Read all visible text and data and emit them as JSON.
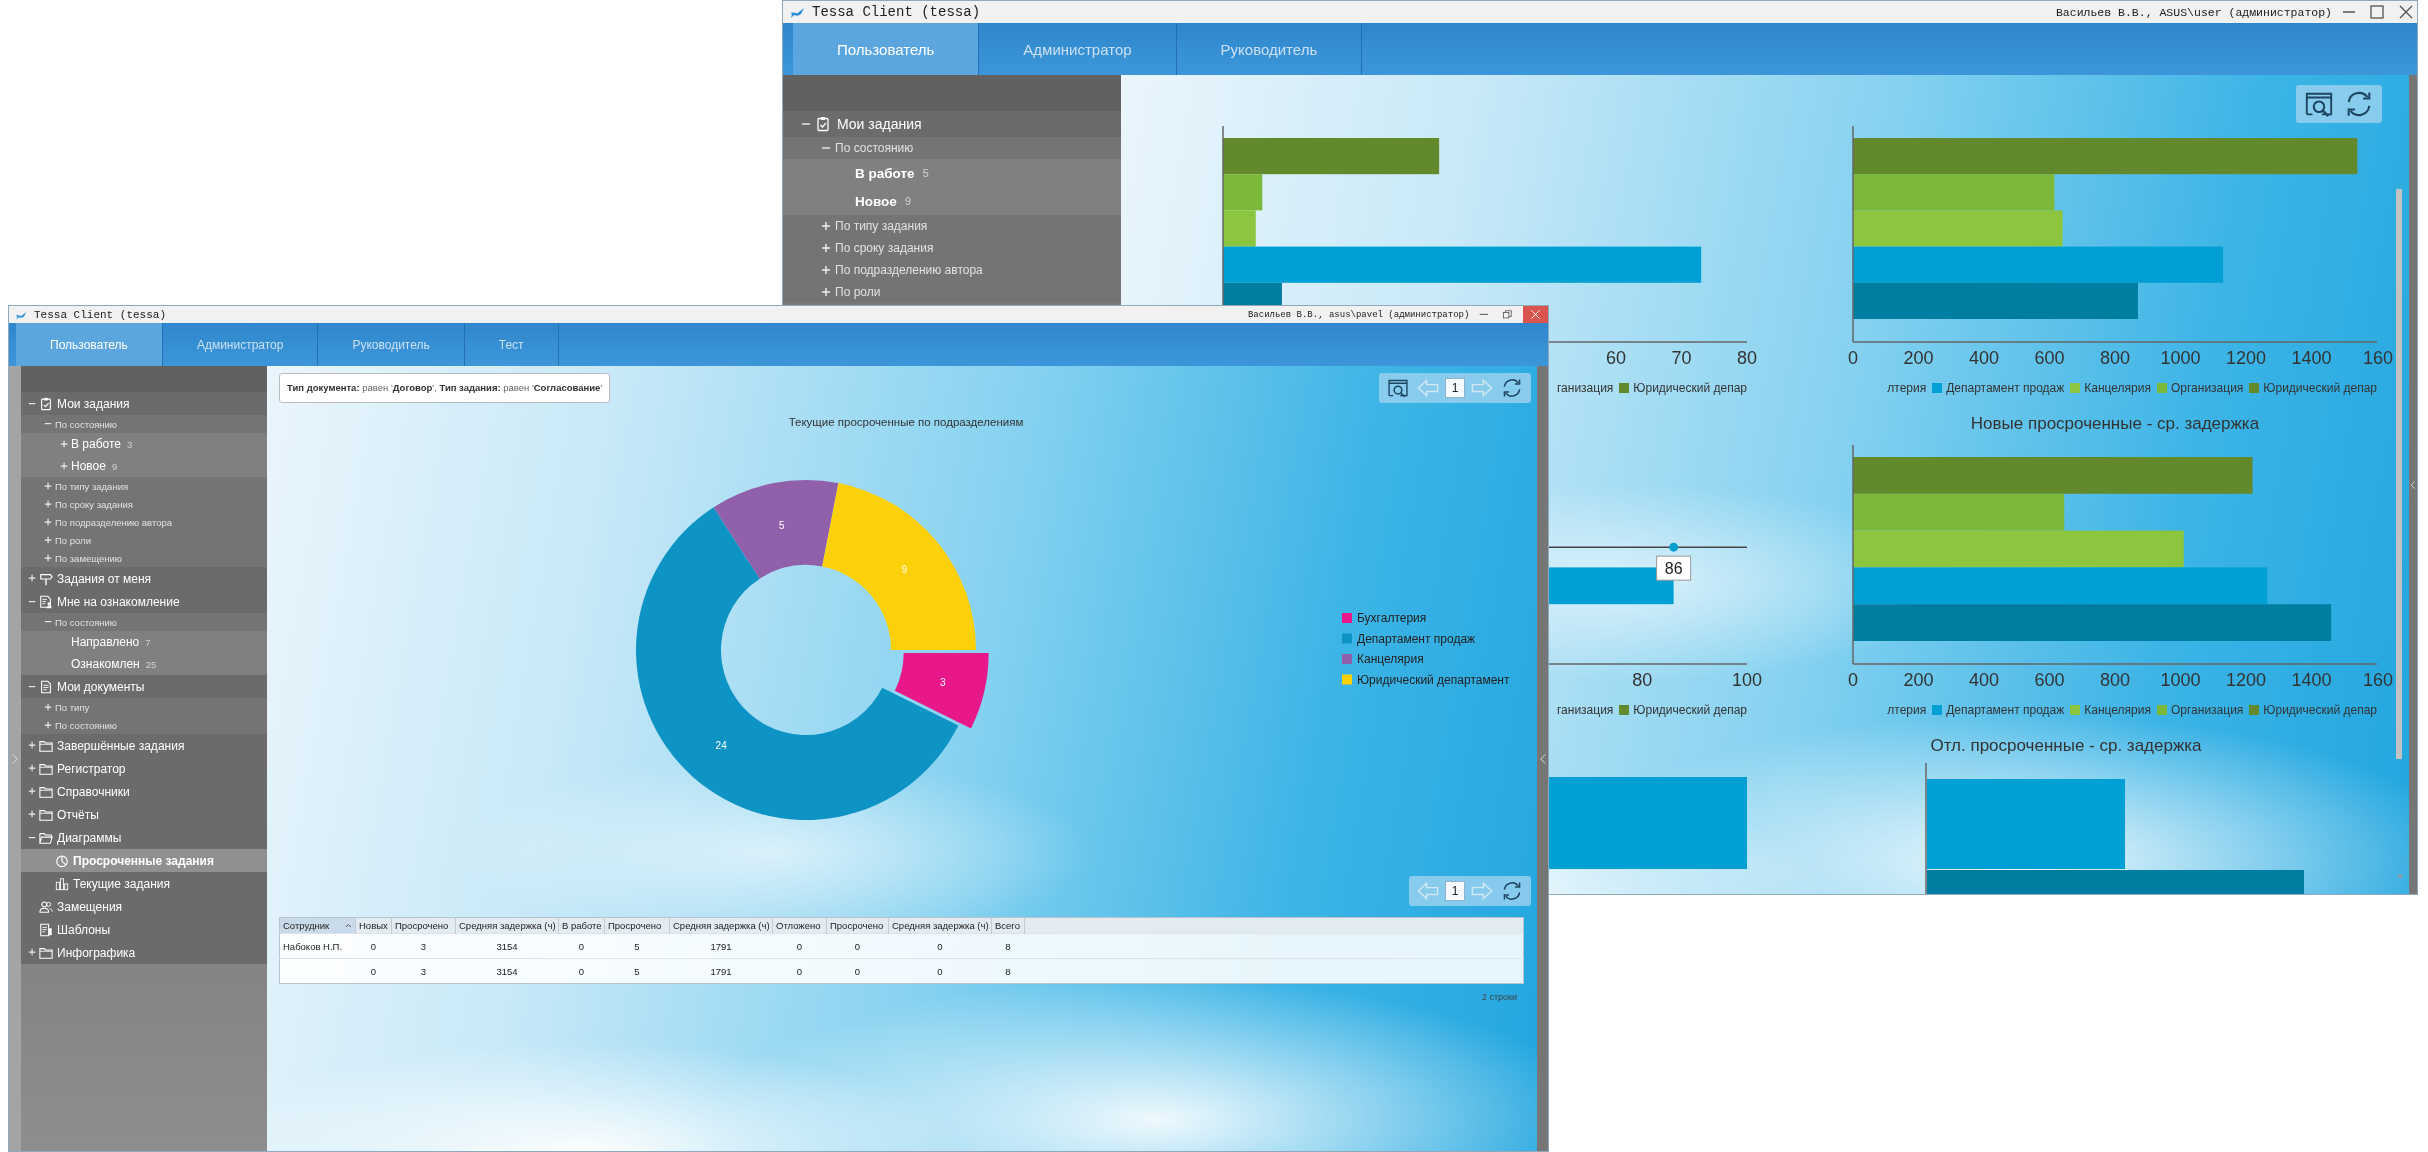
{
  "back_window": {
    "title": "Tessa Client (tessa)",
    "user": "Васильев В.В., ASUS\\user (администратор)",
    "tabs": [
      {
        "label": "Пользователь",
        "selected": true
      },
      {
        "label": "Администратор",
        "selected": false
      },
      {
        "label": "Руководитель",
        "selected": false
      }
    ],
    "sidebar": [
      {
        "label": "Мои задания",
        "kind": "clipboard",
        "expanded": true,
        "children": [
          {
            "label": "По состоянию",
            "expanded": true,
            "children": [
              {
                "label": "В работе",
                "count": "5"
              },
              {
                "label": "Новое",
                "count": "9"
              }
            ]
          },
          {
            "label": "По типу задания",
            "expanded": false
          },
          {
            "label": "По сроку задания",
            "expanded": false
          },
          {
            "label": "По подразделению автора",
            "expanded": false
          },
          {
            "label": "По роли",
            "expanded": false
          }
        ]
      }
    ],
    "toolbar": [
      {
        "kind": "search"
      },
      {
        "kind": "refresh"
      }
    ],
    "charts": [
      {
        "kind": "chart",
        "chart_data": {
          "type": "bar",
          "orientation": "horizontal",
          "xlim": [
            0,
            80
          ],
          "xticks": [
            60,
            70,
            80
          ],
          "series": [
            {
              "color": "#63892d",
              "values": [
                33
              ]
            },
            {
              "color": "#7cb83a",
              "values": [
                6
              ]
            },
            {
              "color": "#8cc63e",
              "values": [
                5
              ]
            },
            {
              "color": "#00a0d4",
              "values": [
                73
              ]
            },
            {
              "color": "#007ea2",
              "values": [
                9
              ]
            }
          ]
        },
        "legend": [
          {
            "label": "ганизация"
          },
          {
            "label": "Юридический депар",
            "color": "#63892d"
          }
        ]
      },
      {
        "kind": "chart",
        "chart_data": {
          "type": "bar",
          "orientation": "horizontal",
          "xlim": [
            0,
            1600
          ],
          "xticks": [
            0,
            200,
            400,
            600,
            800,
            1000,
            1200,
            1400
          ],
          "series": [
            {
              "color": "#63892d",
              "values": [
                1540
              ]
            },
            {
              "color": "#7cb83a",
              "values": [
                615
              ]
            },
            {
              "color": "#8cc63e",
              "values": [
                640
              ]
            },
            {
              "color": "#00a0d4",
              "values": [
                1130
              ]
            },
            {
              "color": "#007ea2",
              "values": [
                870
              ]
            }
          ]
        },
        "cut_tick": "160",
        "legend": [
          {
            "label": "лтерия"
          },
          {
            "label": "Департамент продаж",
            "color": "#00a0d4"
          },
          {
            "label": "Канцелярия",
            "color": "#8cc63e"
          },
          {
            "label": "Организация",
            "color": "#7cb83a"
          },
          {
            "label": "Юридический депар",
            "color": "#63892d"
          }
        ]
      },
      {
        "kind": "partial",
        "ticks": [
          "80",
          "100"
        ],
        "tooltip": "86",
        "legend": [
          {
            "label": "ганизация"
          },
          {
            "label": "Юридический депар",
            "color": "#63892d"
          }
        ]
      },
      {
        "kind": "chart",
        "chart_data": {
          "type": "bar",
          "orientation": "horizontal",
          "title": "Новые просроченные - ср. задержка",
          "xlim": [
            0,
            1600
          ],
          "xticks": [
            0,
            200,
            400,
            600,
            800,
            1000,
            1200,
            1400
          ],
          "series": [
            {
              "color": "#63892d",
              "values": [
                1220
              ]
            },
            {
              "color": "#7cb83a",
              "values": [
                645
              ]
            },
            {
              "color": "#8cc63e",
              "values": [
                1010
              ]
            },
            {
              "color": "#00a0d4",
              "values": [
                1265
              ]
            },
            {
              "color": "#007ea2",
              "values": [
                1460
              ]
            }
          ]
        },
        "cut_tick": "160",
        "legend": [
          {
            "label": "лтерия"
          },
          {
            "label": "Департамент продаж",
            "color": "#00a0d4"
          },
          {
            "label": "Канцелярия",
            "color": "#8cc63e"
          },
          {
            "label": "Организация",
            "color": "#7cb83a"
          },
          {
            "label": "Юридический депар",
            "color": "#63892d"
          }
        ]
      },
      {
        "kind": "picture"
      },
      {
        "kind": "picture",
        "title": "Отл. просроченные - ср. задержка"
      }
    ]
  },
  "front_window": {
    "title": "Tessa Client (tessa)",
    "user": "Васильев В.В., asus\\pavel (администратор)",
    "tabs": [
      {
        "label": "Пользователь",
        "selected": true
      },
      {
        "label": "Администратор",
        "selected": false
      },
      {
        "label": "Руководитель",
        "selected": false
      },
      {
        "label": "Тест",
        "selected": false
      }
    ],
    "sidebar": [
      {
        "label": "Мои задания",
        "kind": "clipboard",
        "expanded": true,
        "selected": false,
        "children": [
          {
            "label": "По состоянию",
            "expanded": true,
            "selected": false,
            "children": [
              {
                "label": "В работе",
                "count": "3",
                "expanded": false,
                "selected": false
              },
              {
                "label": "Новое",
                "count": "9",
                "expanded": false,
                "selected": false
              }
            ]
          },
          {
            "label": "По типу задания",
            "expanded": false,
            "selected": false
          },
          {
            "label": "По сроку задания",
            "expanded": false,
            "selected": false
          },
          {
            "label": "По подразделению автора",
            "expanded": false,
            "selected": false
          },
          {
            "label": "По роли",
            "expanded": false,
            "selected": false
          },
          {
            "label": "По замещению",
            "expanded": false,
            "selected": false
          }
        ]
      },
      {
        "label": "Задания от меня",
        "kind": "signpost",
        "expanded": false,
        "selected": false
      },
      {
        "label": "Мне на ознакомление",
        "kind": "reader",
        "expanded": true,
        "selected": false,
        "children": [
          {
            "label": "По состоянию",
            "expanded": true,
            "selected": false,
            "children": [
              {
                "label": "Направлено",
                "count": "7",
                "selected": false
              },
              {
                "label": "Ознакомлен",
                "count": "25",
                "selected": false
              }
            ]
          }
        ]
      },
      {
        "label": "Мои документы",
        "kind": "document",
        "expanded": true,
        "selected": false,
        "children": [
          {
            "label": "По типу",
            "expanded": false,
            "selected": false
          },
          {
            "label": "По состоянию",
            "expanded": false,
            "selected": false
          }
        ]
      },
      {
        "label": "Завершённые задания",
        "kind": "folder",
        "expanded": false,
        "selected": false
      },
      {
        "label": "Регистратор",
        "kind": "folder",
        "expanded": false,
        "selected": false
      },
      {
        "label": "Справочники",
        "kind": "folder",
        "expanded": false,
        "selected": false
      },
      {
        "label": "Отчёты",
        "kind": "folder",
        "expanded": false,
        "selected": false
      },
      {
        "label": "Диаграммы",
        "kind": "openfolder",
        "expanded": true,
        "selected": false,
        "children": [
          {
            "label": "Просроченные задания",
            "kind": "pie",
            "selected": true
          },
          {
            "label": "Текущие задания",
            "kind": "bars",
            "selected": false
          }
        ]
      },
      {
        "label": "Замещения",
        "kind": "people",
        "selected": false
      },
      {
        "label": "Шаблоны",
        "kind": "template",
        "selected": false
      },
      {
        "label": "Инфографика",
        "kind": "folder",
        "expanded": false,
        "selected": false
      }
    ],
    "filter": "**Тип документа:** равен '**Договор**', **Тип задания:** равен '**Согласование**'",
    "toolbar": [
      {
        "kind": "search",
        "disabled": false
      },
      {
        "kind": "prev",
        "disabled": true
      },
      {
        "kind": "page",
        "value": "1"
      },
      {
        "kind": "next",
        "disabled": true
      },
      {
        "kind": "refresh",
        "disabled": false
      }
    ],
    "chart_data": {
      "type": "donut",
      "title": "Текущие просроченные по подразделениям",
      "data_labels": true,
      "legend": "right",
      "categories": [
        "Бухгалтерия",
        "Департамент продаж",
        "Канцелярия",
        "Юридический департамент"
      ],
      "values": [
        3,
        24,
        5,
        9
      ]
    },
    "slices": [
      {
        "color": "#e8178a",
        "exploded": true
      },
      {
        "color": "#0e94c4",
        "exploded": false
      },
      {
        "color": "#9160aa",
        "exploded": false
      },
      {
        "color": "#fdd10a",
        "exploded": false
      }
    ],
    "table_toolbar": [
      {
        "kind": "prev",
        "disabled": true
      },
      {
        "kind": "page",
        "value": "1"
      },
      {
        "kind": "next",
        "disabled": true
      },
      {
        "kind": "refresh",
        "disabled": false
      }
    ],
    "table": {
      "columns": [
        {
          "label": "Сотрудник",
          "sorted": true
        },
        {
          "label": "Новых",
          "sorted": false
        },
        {
          "label": "Просрочено",
          "sorted": false
        },
        {
          "label": "Средняя задержка (ч)",
          "sorted": false
        },
        {
          "label": "В работе",
          "sorted": false
        },
        {
          "label": "Просрочено",
          "sorted": false
        },
        {
          "label": "Средняя задержка (ч)",
          "sorted": false
        },
        {
          "label": "Отложено",
          "sorted": false
        },
        {
          "label": "Просрочено",
          "sorted": false
        },
        {
          "label": "Средняя задержка (ч)",
          "sorted": false
        },
        {
          "label": "Всего",
          "sorted": false
        }
      ],
      "rows": [
        {
          "employee": "Набоков Н.П.",
          "values": [
            "0",
            "3",
            "3154",
            "0",
            "5",
            "1791",
            "0",
            "0",
            "0",
            "8"
          ]
        },
        {
          "values": [
            "0",
            "3",
            "3154",
            "0",
            "5",
            "1791",
            "0",
            "0",
            "0",
            "8"
          ]
        }
      ]
    },
    "row_count": "2 строки"
  }
}
